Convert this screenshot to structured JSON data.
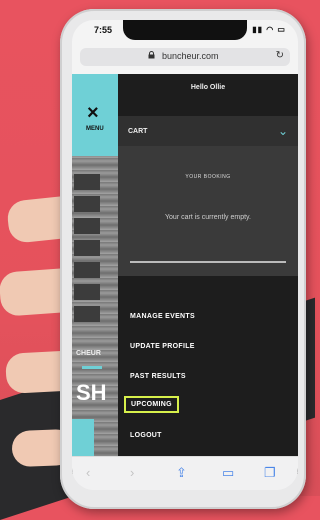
{
  "status_bar": {
    "time": "7:55",
    "icons": "▮▮ ◠ ▭"
  },
  "browser": {
    "lock_icon": "lock-icon",
    "url": "buncheur.com",
    "reload_icon": "↻"
  },
  "site": {
    "menu_button": {
      "icon": "×",
      "label": "MENU"
    },
    "left_text": {
      "cheur": "CHEUR",
      "sh": "SH"
    },
    "panel": {
      "greeting": "Hello Ollie",
      "cart": {
        "label": "CART",
        "chevron": "⌄",
        "booking_label": "YOUR BOOKING",
        "empty_text": "Your cart is currently empty."
      },
      "menu_items": [
        "MANAGE EVENTS",
        "UPDATE PROFILE",
        "PAST RESULTS",
        "UPCOMING",
        "LOGOUT"
      ]
    }
  },
  "toolbar": {
    "back": "‹",
    "forward": "›",
    "share": "⇪",
    "bookmarks": "▭",
    "tabs": "❐"
  },
  "colors": {
    "accent_cyan": "#6fd0d6",
    "highlight": "#d7f04b",
    "background": "#e8535f"
  }
}
